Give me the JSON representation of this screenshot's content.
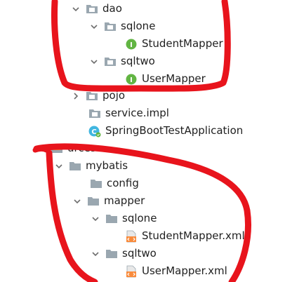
{
  "tree": {
    "rows": [
      {
        "label": "dao",
        "icon": "package-folder-icon",
        "chevron": "chevron-down-icon"
      },
      {
        "label": "sqlone",
        "icon": "package-folder-icon",
        "chevron": "chevron-down-icon"
      },
      {
        "label": "StudentMapper",
        "icon": "interface-icon",
        "icon_letter": "I"
      },
      {
        "label": "sqltwo",
        "icon": "package-folder-icon",
        "chevron": "chevron-down-icon"
      },
      {
        "label": "UserMapper",
        "icon": "interface-icon",
        "icon_letter": "I"
      },
      {
        "label": "pojo",
        "icon": "package-folder-icon",
        "chevron": "chevron-right-icon"
      },
      {
        "label": "service.impl",
        "icon": "package-folder-icon"
      },
      {
        "label": "SpringBootTestApplication",
        "icon": "spring-class-icon",
        "icon_letter": "C"
      },
      {
        "label": "urces",
        "icon": "resources-folder-icon",
        "chevron": "chevron-down-icon"
      },
      {
        "label": "mybatis",
        "icon": "folder-icon",
        "chevron": "chevron-down-icon"
      },
      {
        "label": "config",
        "icon": "folder-icon"
      },
      {
        "label": "mapper",
        "icon": "folder-icon",
        "chevron": "chevron-down-icon"
      },
      {
        "label": "sqlone",
        "icon": "folder-icon",
        "chevron": "chevron-down-icon"
      },
      {
        "label": "StudentMapper.xml",
        "icon": "xml-file-icon"
      },
      {
        "label": "sqltwo",
        "icon": "folder-icon",
        "chevron": "chevron-down-icon"
      },
      {
        "label": "UserMapper.xml",
        "icon": "xml-file-icon"
      }
    ]
  },
  "colors": {
    "folder": "#9aa7b0",
    "chevron": "#6e6e6e",
    "interface_fill": "#62b543",
    "class_fill": "#40b6e0",
    "xml_fill": "#f98b3c",
    "annotation_red": "#e8141c"
  }
}
